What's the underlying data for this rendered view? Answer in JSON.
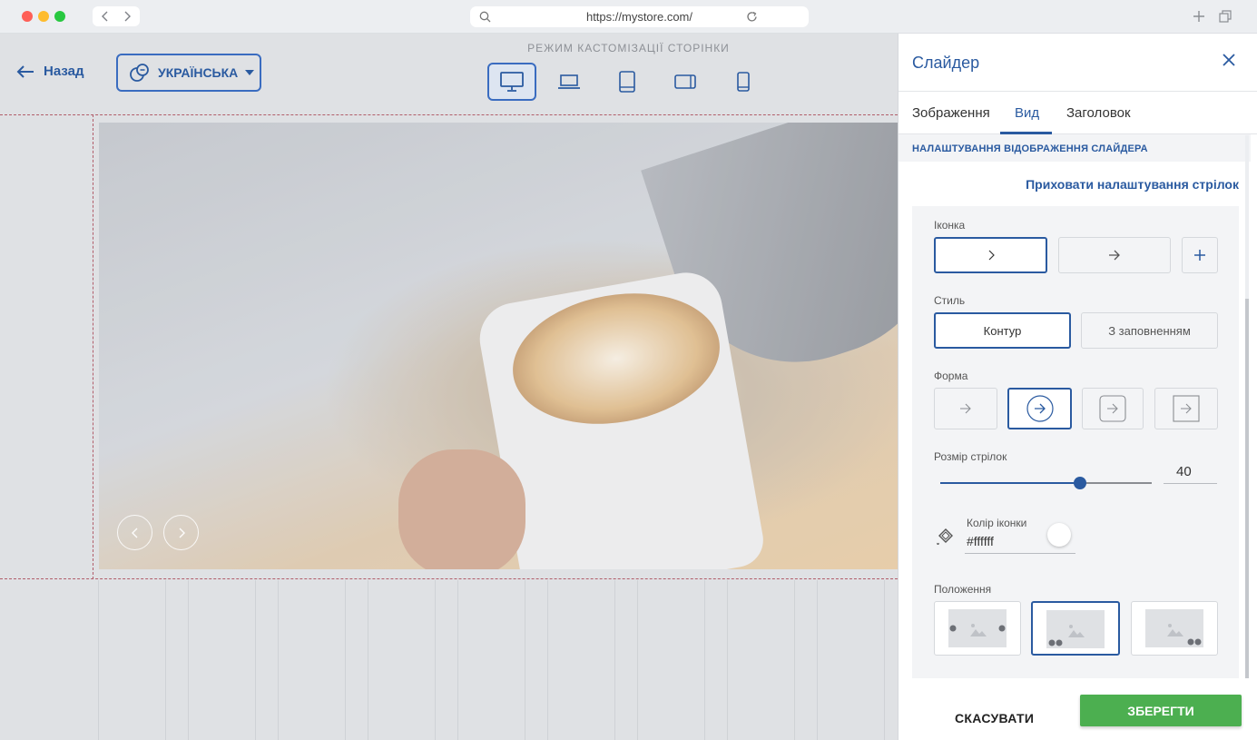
{
  "browser": {
    "url": "https://mystore.com/",
    "icons": [
      "back-icon",
      "forward-icon",
      "search-icon",
      "reload-icon",
      "new-tab-icon",
      "tabs-overview-icon"
    ]
  },
  "editor": {
    "back_label": "Назад",
    "language_label": "УКРАЇНСЬКА",
    "mode_label": "РЕЖИМ КАСТОМІЗАЦІЇ СТОРІНКИ",
    "devices": [
      "desktop",
      "laptop",
      "tablet-portrait",
      "tablet-landscape",
      "phone"
    ],
    "active_device": "desktop"
  },
  "panel": {
    "title": "Слайдер",
    "tabs": [
      "Зображення",
      "Вид",
      "Заголовок"
    ],
    "active_tab": "Вид",
    "section_title": "НАЛАШТУВАННЯ ВІДОБРАЖЕННЯ СЛАЙДЕРА",
    "hide_arrows_link": "Приховати налаштування стрілок",
    "icon_label": "Іконка",
    "style_label": "Стиль",
    "style_options": [
      "Контур",
      "З заповненням"
    ],
    "selected_style": "Контур",
    "shape_label": "Форма",
    "arrow_size_label": "Розмір стрілок",
    "arrow_size_value": "40",
    "arrow_size_fraction": 0.66,
    "icon_color_label": "Колір іконки",
    "icon_color_value": "#ffffff",
    "position_label": "Положення",
    "cancel_label": "СКАСУВАТИ",
    "save_label": "ЗБЕРЕГТИ"
  },
  "colors": {
    "accent": "#2a5aa0",
    "save_green": "#4caf50"
  }
}
